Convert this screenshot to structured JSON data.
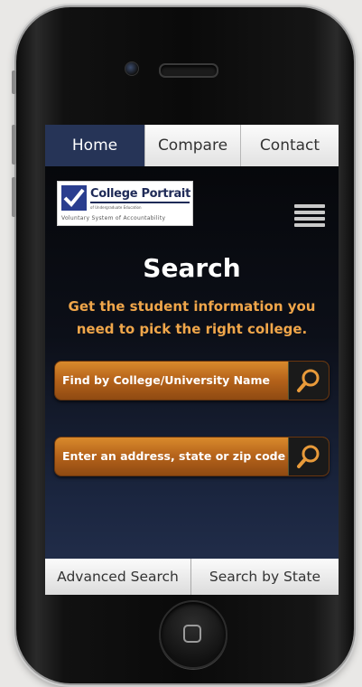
{
  "tabs": [
    {
      "label": "Home"
    },
    {
      "label": "Compare"
    },
    {
      "label": "Contact"
    }
  ],
  "logo": {
    "name": "College Portrait",
    "sub": "of Undergraduate Education",
    "tagline": "Voluntary System of Accountability"
  },
  "main": {
    "title": "Search",
    "subtitle": "Get the student information you need to pick the right college."
  },
  "search": {
    "college_label": "Find by College/University Name",
    "address_label": "Enter an address, state or zip code"
  },
  "bottom": {
    "advanced": "Advanced Search",
    "by_state": "Search by State"
  },
  "colors": {
    "tab_active": "#263457",
    "accent_text": "#f0a64a",
    "button_orange": "#c06c1f"
  }
}
